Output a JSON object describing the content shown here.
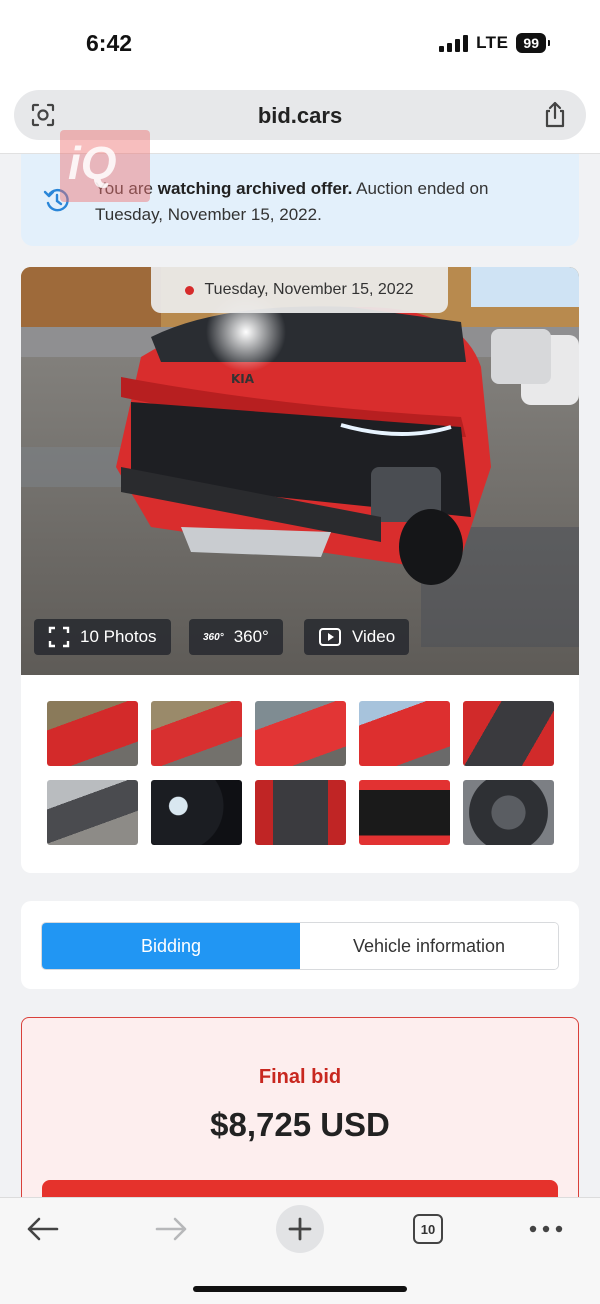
{
  "status_bar": {
    "time": "6:42",
    "network": "LTE",
    "battery": "99"
  },
  "address_bar": {
    "domain": "bid.cars"
  },
  "banner": {
    "text_before": "You are ",
    "text_bold": "watching archived offer.",
    "text_after": " Auction ended on Tuesday, November 15, 2022."
  },
  "watermark": {
    "text": "iQ"
  },
  "gallery": {
    "date": "Tuesday, November 15, 2022",
    "buttons": {
      "photos": "10 Photos",
      "rotate_badge": "360°",
      "rotate": "360°",
      "video": "Video"
    }
  },
  "tabs": {
    "bidding": "Bidding",
    "vehicle_info": "Vehicle information"
  },
  "final_bid": {
    "label": "Final bid",
    "amount": "$8,725 USD"
  },
  "toolbar": {
    "tab_count": "10"
  },
  "colors": {
    "accent": "#2196f3",
    "bid_red": "#c8271f",
    "banner_bg": "#e3f0fb",
    "car_red": "#d92d2d"
  }
}
